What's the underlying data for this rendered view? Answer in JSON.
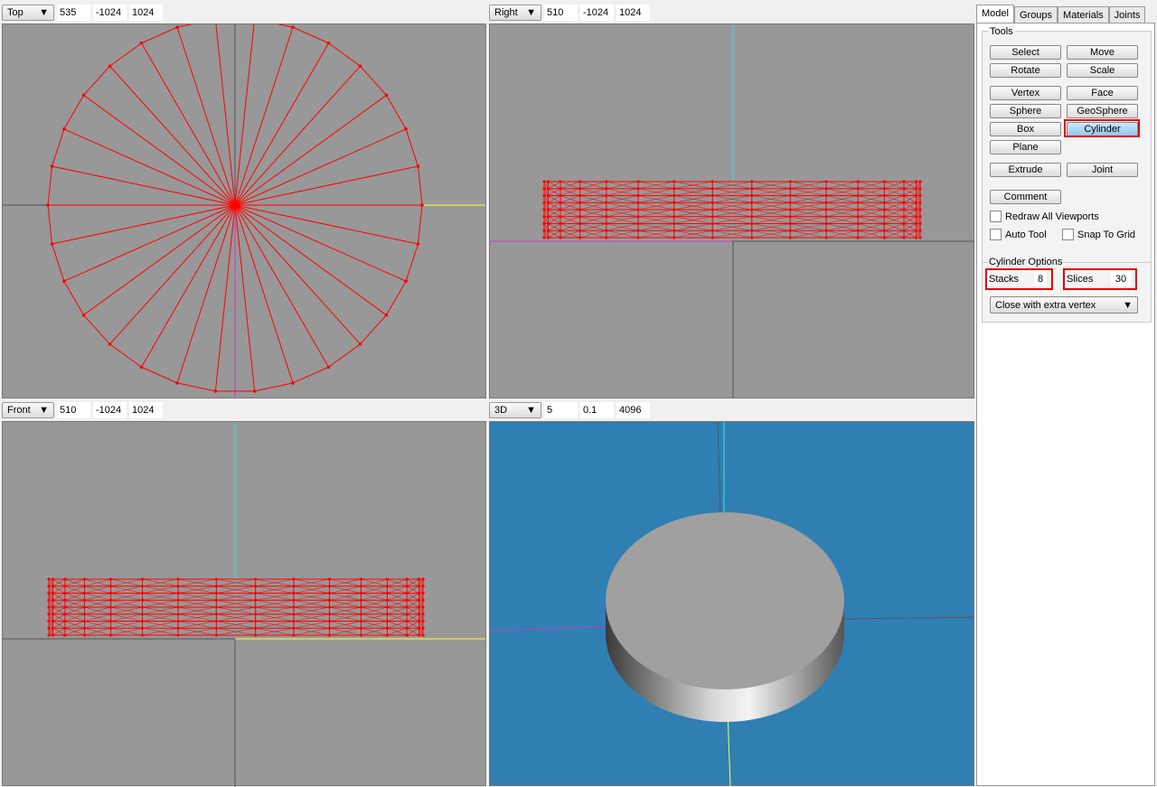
{
  "viewports": [
    {
      "view": "Top",
      "fields": [
        "535",
        "-1024",
        "1024"
      ]
    },
    {
      "view": "Right",
      "fields": [
        "510",
        "-1024",
        "1024"
      ]
    },
    {
      "view": "Front",
      "fields": [
        "510",
        "-1024",
        "1024"
      ]
    },
    {
      "view": "3D",
      "fields": [
        "5",
        "0.1",
        "4096"
      ]
    }
  ],
  "tabs": [
    "Model",
    "Groups",
    "Materials",
    "Joints"
  ],
  "active_tab": "Model",
  "tools": {
    "title": "Tools",
    "buttons": [
      "Select",
      "Move",
      "Rotate",
      "Scale",
      "Vertex",
      "Face",
      "Sphere",
      "GeoSphere",
      "Box",
      "Cylinder",
      "Plane",
      "Extrude",
      "Joint",
      "Comment"
    ],
    "selected": "Cylinder",
    "checkboxes": [
      {
        "label": "Redraw All Viewports",
        "checked": false
      },
      {
        "label": "Auto Tool",
        "checked": false
      },
      {
        "label": "Snap To Grid",
        "checked": false
      }
    ]
  },
  "cylinder_options": {
    "title": "Cylinder Options",
    "stacks_label": "Stacks",
    "stacks": "8",
    "slices_label": "Slices",
    "slices": "30",
    "close_mode": "Close with extra vertex"
  },
  "colors": {
    "mesh": "#ff0000",
    "viewport_bg": "#989898",
    "viewport_3d_bg": "#2f7fb3",
    "highlight": "#e00000"
  }
}
